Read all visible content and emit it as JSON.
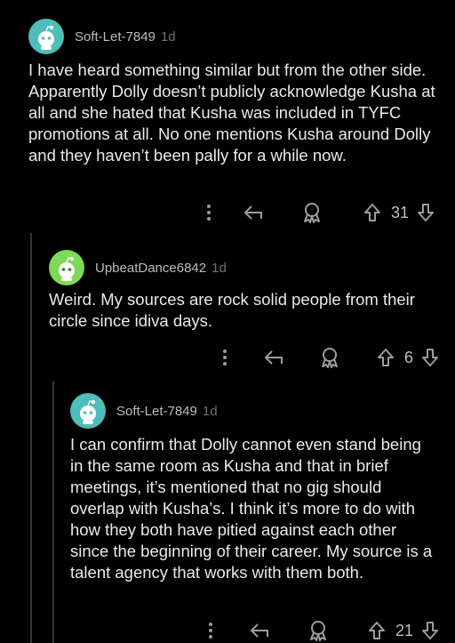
{
  "colors": {
    "background": "#000000",
    "avatar_teal": "#4fbdba",
    "avatar_green": "#7ed957",
    "thread_line": "#343536"
  },
  "comments": [
    {
      "username": "Soft-Let-7849",
      "age": "1d",
      "avatar": "snoo-avatar-teal",
      "text": "I have heard something similar but from the other side. Apparently Dolly doesn’t publicly acknowledge Kusha at all and she hated that Kusha was included in TYFC promotions at all. No one mentions Kusha around Dolly and they haven’t been pally for a while now.",
      "votes": "31"
    },
    {
      "username": "UpbeatDance6842",
      "age": "1d",
      "avatar": "snoo-avatar-green",
      "text": "Weird. My sources are rock solid people from their circle since idiva days.",
      "votes": "6"
    },
    {
      "username": "Soft-Let-7849",
      "age": "1d",
      "avatar": "snoo-avatar-teal",
      "text": "I can confirm that Dolly cannot even stand being in the same room as Kusha and that in brief meetings, it’s mentioned that no gig should overlap with Kusha’s. I think it’s more to do with how they both have pitied against each other since the beginning of their career. My source is a talent agency that works with them both.",
      "votes": "21"
    }
  ],
  "icons": {
    "more": "more-options-icon",
    "reply": "reply-icon",
    "award": "award-icon",
    "upvote": "upvote-icon",
    "downvote": "downvote-icon"
  }
}
